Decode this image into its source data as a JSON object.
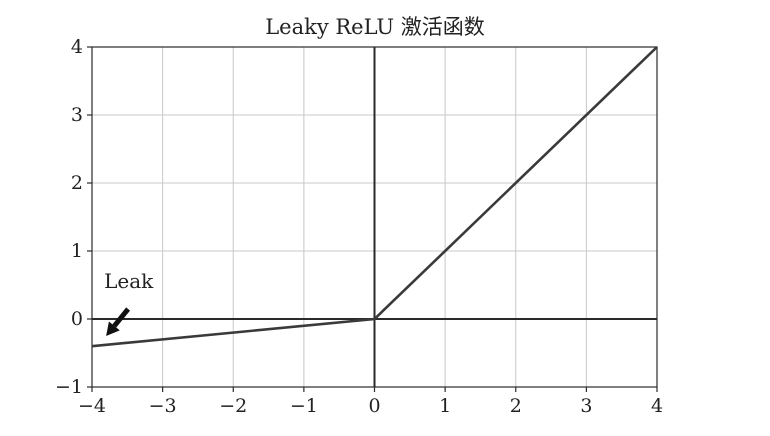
{
  "chart_data": {
    "type": "line",
    "title": "Leaky ReLU 激活函数",
    "xlabel": "",
    "ylabel": "",
    "xlim": [
      -4,
      4
    ],
    "ylim": [
      -1,
      4
    ],
    "x_ticks": [
      -4,
      -3,
      -2,
      -1,
      0,
      1,
      2,
      3,
      4
    ],
    "y_ticks": [
      -1,
      0,
      1,
      2,
      3,
      4
    ],
    "x_tick_labels": [
      "−4",
      "−3",
      "−2",
      "−1",
      "0",
      "1",
      "2",
      "3",
      "4"
    ],
    "y_tick_labels": [
      "−1",
      "0",
      "1",
      "2",
      "3",
      "4"
    ],
    "grid": true,
    "series": [
      {
        "x": [
          -4,
          0,
          4
        ],
        "y": [
          -0.4,
          0,
          4
        ]
      }
    ],
    "annotations": [
      {
        "text": "Leak",
        "arrow_to": [
          -3.8,
          -0.25
        ]
      }
    ],
    "colors": {
      "line": "#3a3a3a",
      "axis": "#2a2a2a",
      "grid": "#c8c8c8",
      "arrow": "#111111"
    }
  }
}
